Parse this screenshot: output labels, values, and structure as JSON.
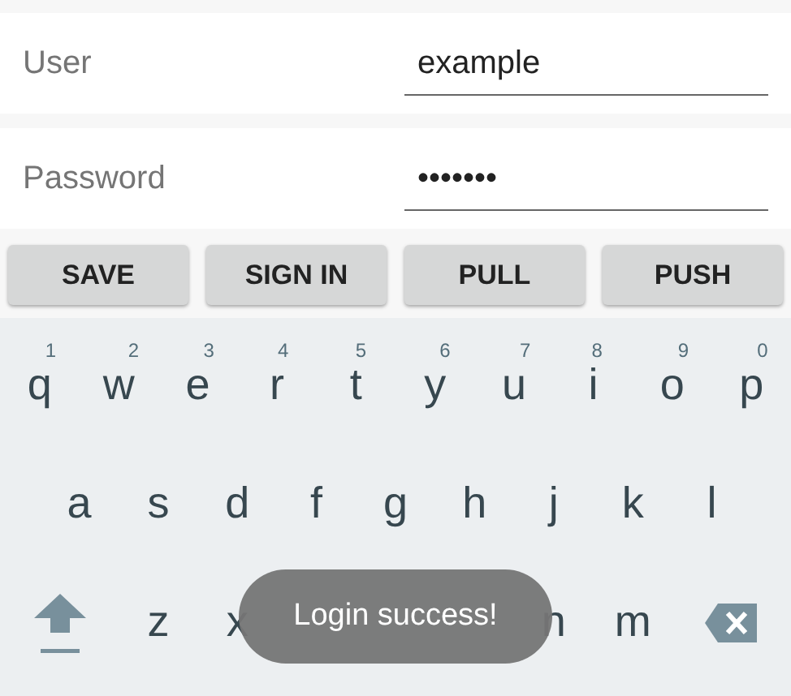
{
  "fields": [
    {
      "label": "User",
      "value": "example"
    },
    {
      "label": "Password",
      "value": "•••••••"
    }
  ],
  "buttons": [
    "SAVE",
    "SIGN IN",
    "PULL",
    "PUSH"
  ],
  "keyboard": {
    "rows": [
      {
        "keys": [
          {
            "kind": "letter",
            "label": "q",
            "hint": "1"
          },
          {
            "kind": "letter",
            "label": "w",
            "hint": "2"
          },
          {
            "kind": "letter",
            "label": "e",
            "hint": "3"
          },
          {
            "kind": "letter",
            "label": "r",
            "hint": "4"
          },
          {
            "kind": "letter",
            "label": "t",
            "hint": "5"
          },
          {
            "kind": "letter",
            "label": "y",
            "hint": "6"
          },
          {
            "kind": "letter",
            "label": "u",
            "hint": "7"
          },
          {
            "kind": "letter",
            "label": "i",
            "hint": "8"
          },
          {
            "kind": "letter",
            "label": "o",
            "hint": "9"
          },
          {
            "kind": "letter",
            "label": "p",
            "hint": "0"
          }
        ]
      },
      {
        "keys": [
          {
            "kind": "letter",
            "label": "a"
          },
          {
            "kind": "letter",
            "label": "s"
          },
          {
            "kind": "letter",
            "label": "d"
          },
          {
            "kind": "letter",
            "label": "f"
          },
          {
            "kind": "letter",
            "label": "g"
          },
          {
            "kind": "letter",
            "label": "h"
          },
          {
            "kind": "letter",
            "label": "j"
          },
          {
            "kind": "letter",
            "label": "k"
          },
          {
            "kind": "letter",
            "label": "l"
          }
        ]
      },
      {
        "keys": [
          {
            "kind": "shift"
          },
          {
            "kind": "letter",
            "label": "z"
          },
          {
            "kind": "letter",
            "label": "x"
          },
          {
            "kind": "covered"
          },
          {
            "kind": "covered"
          },
          {
            "kind": "covered"
          },
          {
            "kind": "letter",
            "label": "n"
          },
          {
            "kind": "letter",
            "label": "m"
          },
          {
            "kind": "backspace"
          }
        ]
      }
    ]
  },
  "toast": "Login success!"
}
